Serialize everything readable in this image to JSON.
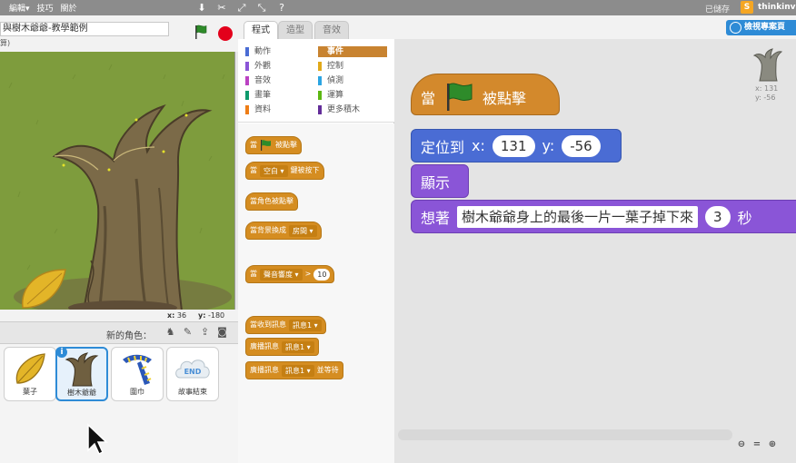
{
  "menu": {
    "items": [
      "編輯▾",
      "技巧",
      "關於"
    ]
  },
  "toolbar_icons": [
    "duplicate-icon",
    "cut-icon",
    "grow-icon",
    "shrink-icon",
    "help-icon"
  ],
  "account": {
    "saved_label": "已儲存",
    "name": "thinkinvi",
    "icon_letter": "S"
  },
  "project": {
    "title": "與樹木爺爺-教學範例",
    "byline": "算)"
  },
  "stage": {
    "x_label": "x:",
    "x_value": "36",
    "y_label": "y:",
    "y_value": "-180"
  },
  "sprites": {
    "new_sprite_label": "新的角色：",
    "items": [
      {
        "name": "葉子",
        "icon": "leaf-sprite"
      },
      {
        "name": "樹木爺爺",
        "icon": "tree-stump-sprite",
        "selected": true
      },
      {
        "name": "圍巾",
        "icon": "scarf-sprite"
      },
      {
        "name": "故事結束",
        "icon": "end-cloud-sprite",
        "label": "END"
      }
    ]
  },
  "tabs": {
    "items": [
      "程式",
      "造型",
      "音效"
    ],
    "active": 0
  },
  "view_project": {
    "label": "檢視專案頁"
  },
  "categories": [
    {
      "label": "動作",
      "color": "#4a6cd4"
    },
    {
      "label": "事件",
      "color": "#c88330",
      "active": true
    },
    {
      "label": "外觀",
      "color": "#8a55d7"
    },
    {
      "label": "控制",
      "color": "#e1a91a"
    },
    {
      "label": "音效",
      "color": "#bb42c3"
    },
    {
      "label": "偵測",
      "color": "#2ca5e2"
    },
    {
      "label": "畫筆",
      "color": "#0e9a6c"
    },
    {
      "label": "運算",
      "color": "#5cb712"
    },
    {
      "label": "資料",
      "color": "#ee7d16"
    },
    {
      "label": "更多積木",
      "color": "#632d99"
    }
  ],
  "palette_blocks": {
    "flag_clicked": {
      "pre": "當",
      "post": "被點擊"
    },
    "key_pressed": {
      "pre": "當",
      "slot": "空白",
      "post": "鍵被按下"
    },
    "sprite_clicked": {
      "text": "當角色被點擊"
    },
    "backdrop_switch": {
      "pre": "當背景換成",
      "slot": "房間"
    },
    "loudness": {
      "pre": "當",
      "slot": "聲音響度",
      "op": ">",
      "num": "10"
    },
    "receive": {
      "pre": "當收到訊息",
      "slot": "訊息1"
    },
    "broadcast": {
      "pre": "廣播訊息",
      "slot": "訊息1"
    },
    "broadcast_wait": {
      "pre": "廣播訊息",
      "slot": "訊息1",
      "post": "並等待"
    }
  },
  "script": {
    "hat": {
      "pre": "當",
      "post": "被點擊"
    },
    "goto": {
      "label": "定位到",
      "x_label": "x:",
      "x": "131",
      "y_label": "y:",
      "y": "-56"
    },
    "show": {
      "label": "顯示"
    },
    "think": {
      "label": "想著",
      "text": "樹木爺爺身上的最後一片一葉子掉下來",
      "secs": "3",
      "unit": "秒"
    }
  },
  "corner_info": {
    "x": "x: 131",
    "y": "y: -56"
  }
}
